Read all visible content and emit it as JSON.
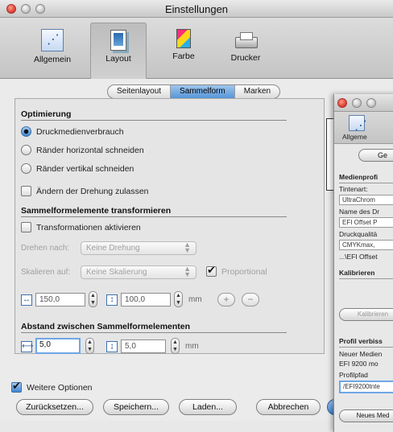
{
  "window": {
    "title": "Einstellungen"
  },
  "toolbar": {
    "items": [
      {
        "label": "Allgemein",
        "icon": "general-icon"
      },
      {
        "label": "Layout",
        "icon": "layout-icon"
      },
      {
        "label": "Farbe",
        "icon": "color-icon"
      },
      {
        "label": "Drucker",
        "icon": "printer-icon"
      }
    ],
    "selected": "Layout"
  },
  "tabs": [
    {
      "label": "Seitenlayout",
      "active": false
    },
    {
      "label": "Sammelform",
      "active": true
    },
    {
      "label": "Marken",
      "active": false
    }
  ],
  "optimization": {
    "title": "Optimierung",
    "options": [
      {
        "label": "Druckmedienverbrauch",
        "selected": true
      },
      {
        "label": "Ränder horizontal schneiden",
        "selected": false
      },
      {
        "label": "Ränder vertikal schneiden",
        "selected": false
      }
    ],
    "allow_rotation": {
      "label": "Ändern der Drehung zulassen",
      "checked": false
    }
  },
  "transform": {
    "title": "Sammelformelemente transformieren",
    "activate": {
      "label": "Transformationen aktivieren",
      "checked": false
    },
    "rotate_label": "Drehen nach:",
    "rotate_value": "Keine Drehung",
    "scale_label": "Skalieren auf:",
    "scale_value": "Keine Skalierung",
    "proportional": {
      "label": "Proportional",
      "checked": true
    },
    "width_value": "150,0",
    "height_value": "100,0",
    "unit": "mm",
    "plus": "+",
    "minus": "−"
  },
  "spacing": {
    "title": "Abstand zwischen Sammelformelementen",
    "horizontal_value": "5,0",
    "vertical_value": "5,0",
    "unit": "mm"
  },
  "more_options": {
    "label": "Weitere Optionen",
    "checked": true
  },
  "buttons": {
    "reset": "Zurücksetzen...",
    "save": "Speichern...",
    "load": "Laden...",
    "cancel": "Abbrechen"
  },
  "second_window": {
    "toolbar_label": "Allgeme",
    "tab_label": "Ge",
    "lines": [
      "Medienprofi",
      "Tintenart:",
      "UltraChrom",
      "Name des Dr",
      "EFI Offset P",
      "Druckqualitä",
      "CMYKmax,",
      "...\\EFI Offset",
      "Kalibrieren",
      "Kalibrieren",
      "Profil verbiss",
      "Neuer Medien",
      "EFI 9200 mo",
      "Profilpfad",
      "/EFI9200tnte",
      "Neues Med"
    ]
  }
}
